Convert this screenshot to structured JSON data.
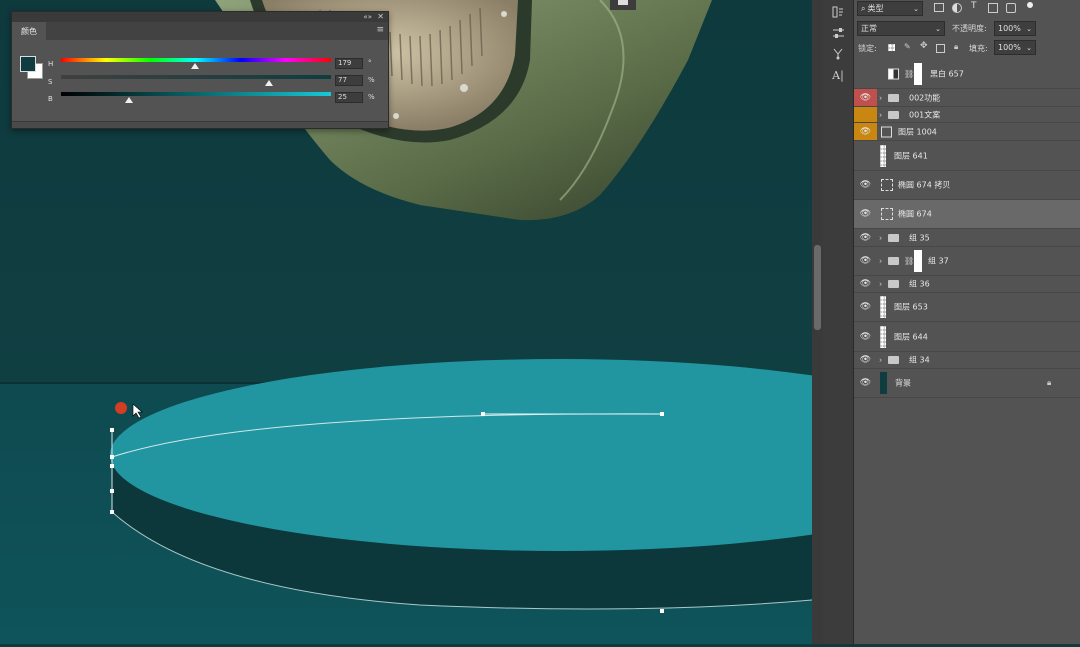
{
  "color_panel": {
    "tab_label": "颜色",
    "collapse_icon": "double-arrow-icon",
    "close_icon": "close-icon",
    "menu_icon": "panel-menu-icon",
    "foreground_color": "#0f3d3f",
    "background_color": "#ffffff",
    "sliders": [
      {
        "label": "H",
        "value": "179",
        "unit": "°",
        "fraction": 0.497
      },
      {
        "label": "S",
        "value": "77",
        "unit": "%",
        "fraction": 0.77
      },
      {
        "label": "B",
        "value": "25",
        "unit": "%",
        "fraction": 0.25
      }
    ]
  },
  "layers_panel": {
    "filter_kind": "类型",
    "blend_mode": "正常",
    "opacity_label": "不透明度:",
    "opacity_value": "100%",
    "lock_label": "锁定:",
    "fill_label": "填充:",
    "fill_value": "100%",
    "layers": [
      {
        "name": "黑白 657",
        "kind": "adjustment",
        "eye": false,
        "color": ""
      },
      {
        "name": "002功能",
        "kind": "group",
        "eye": true,
        "color": "#c0504d"
      },
      {
        "name": "001文案",
        "kind": "group",
        "eye": false,
        "color": "#c98712"
      },
      {
        "name": "图层 1004",
        "kind": "smart",
        "eye": true,
        "color": "#c98712"
      },
      {
        "name": "图层 641",
        "kind": "pixel",
        "eye": false,
        "color": ""
      },
      {
        "name": "椭圆 674 拷贝",
        "kind": "shape",
        "eye": true,
        "color": ""
      },
      {
        "name": "椭圆 674",
        "kind": "shape",
        "eye": true,
        "color": "",
        "selected": true
      },
      {
        "name": "组 35",
        "kind": "group",
        "eye": true,
        "color": ""
      },
      {
        "name": "组 37",
        "kind": "group-mask",
        "eye": true,
        "color": ""
      },
      {
        "name": "组 36",
        "kind": "group",
        "eye": true,
        "color": ""
      },
      {
        "name": "图层 653",
        "kind": "pixel",
        "eye": true,
        "color": ""
      },
      {
        "name": "图层 644",
        "kind": "pixel",
        "eye": true,
        "color": ""
      },
      {
        "name": "组 34",
        "kind": "group",
        "eye": true,
        "color": ""
      },
      {
        "name": "背景",
        "kind": "background",
        "eye": true,
        "color": ""
      }
    ]
  },
  "tools": [
    "history-icon",
    "adjust-icon",
    "brush-settings-icon",
    "character-icon"
  ],
  "canvas": {
    "background_color": "#0f3a3d",
    "floor_color": "#0e4c52",
    "disc_top_color": "#2196a1",
    "disc_side_color": "#0c383c"
  }
}
